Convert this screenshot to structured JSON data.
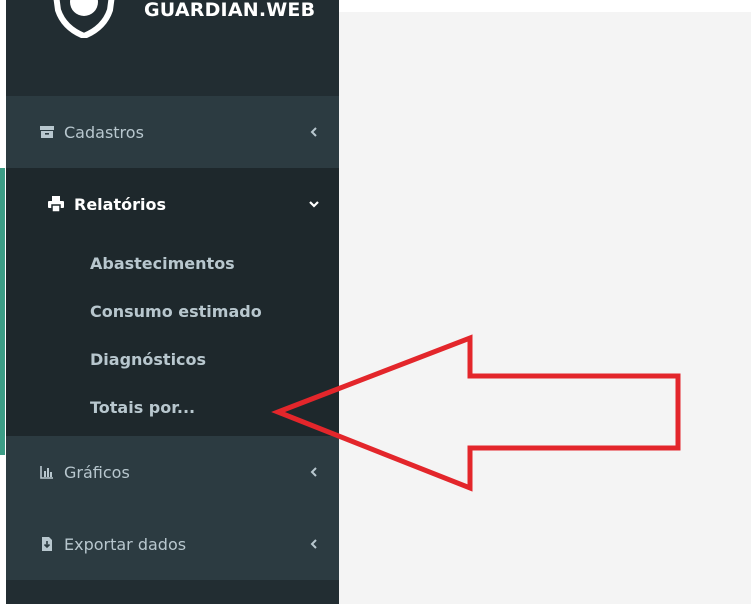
{
  "brand": {
    "name": "GUARDIAN.WEB"
  },
  "nav": {
    "items": [
      {
        "label": "Cadastros",
        "icon": "archive-icon",
        "state": "collapsed"
      },
      {
        "label": "Relatórios",
        "icon": "printer-icon",
        "state": "expanded",
        "subitems": [
          "Abastecimentos",
          "Consumo estimado",
          "Diagnósticos",
          "Totais por..."
        ]
      },
      {
        "label": "Gráficos",
        "icon": "bar-chart-icon",
        "state": "collapsed"
      },
      {
        "label": "Exportar dados",
        "icon": "file-download-icon",
        "state": "collapsed"
      }
    ]
  },
  "annotation": {
    "color": "#e3262b",
    "type": "arrow-pointing-left"
  },
  "colors": {
    "sidebar": "#222d32",
    "active_bar": "#3c9d86",
    "content_bg": "#f4f4f4"
  }
}
